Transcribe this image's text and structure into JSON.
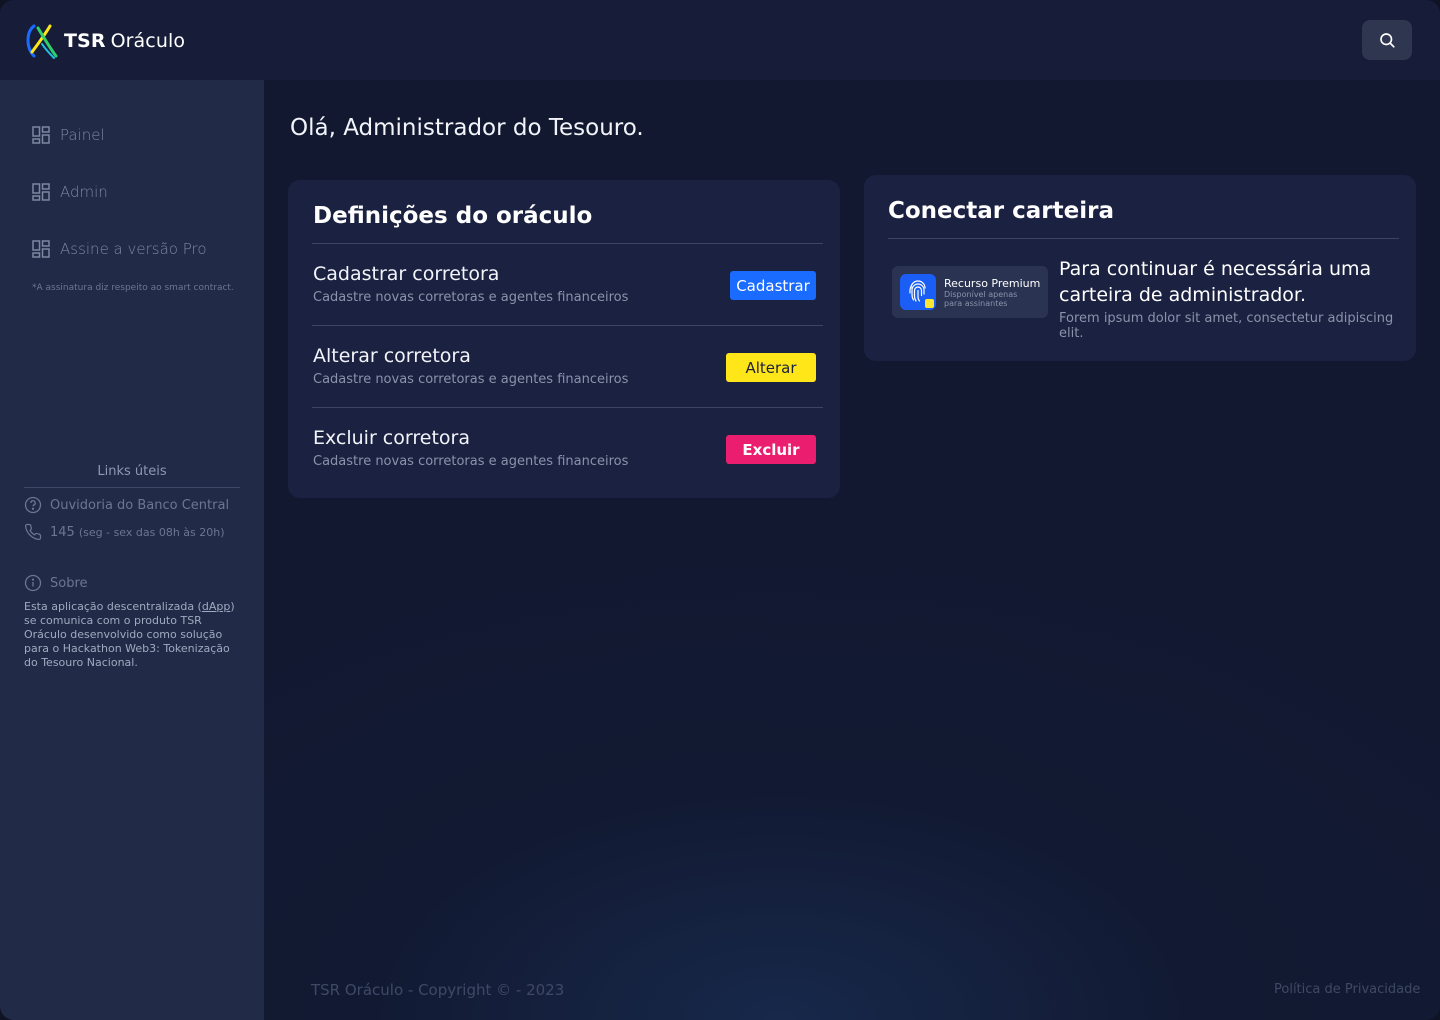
{
  "app": {
    "brand_bold": "TSR",
    "brand_name": "Oráculo"
  },
  "header": {
    "search_icon": "search-icon"
  },
  "sidebar": {
    "items": [
      {
        "label": "Painel",
        "icon": "dashboard-icon"
      },
      {
        "label": "Admin",
        "icon": "dashboard-icon"
      },
      {
        "label": "Assine a versão Pro",
        "icon": "dashboard-icon"
      }
    ],
    "signature_note": "*A assinatura diz respeito ao smart contract.",
    "links_title": "Links úteis",
    "links": [
      {
        "label": "Ouvidoria do Banco Central",
        "icon": "help-circle-icon"
      },
      {
        "label": "145",
        "sub": "(seg - sex das 08h às 20h)",
        "icon": "phone-icon"
      }
    ],
    "about_label": "Sobre",
    "about_text_1": "Esta aplicação descentralizada (",
    "about_link": "dApp",
    "about_text_2": ") se comunica com o produto TSR Oráculo desenvolvido como solução para o Hackathon Web3: Tokenização do Tesouro Nacional."
  },
  "main": {
    "greeting": "Olá, Administrador do Tesouro.",
    "oracle_card": {
      "title": "Definições do oráculo",
      "rows": [
        {
          "title": "Cadastrar corretora",
          "subtitle": "Cadastre novas corretoras e agentes financeiros",
          "button": "Cadastrar",
          "color": "#1a6bff"
        },
        {
          "title": "Alterar corretora",
          "subtitle": "Cadastre novas corretoras e agentes financeiros",
          "button": "Alterar",
          "color": "#ffe619"
        },
        {
          "title": "Excluir corretora",
          "subtitle": "Cadastre novas corretoras e agentes financeiros",
          "button": "Excluir",
          "color": "#ea1d6e"
        }
      ]
    },
    "wallet_card": {
      "title": "Conectar carteira",
      "premium_title": "Recurso Premium",
      "premium_sub": "Disponível apenas para assinantes",
      "message": "Para continuar é necessária uma carteira de administrador.",
      "description": "Forem ipsum dolor sit amet, consectetur adipiscing elit."
    }
  },
  "footer": {
    "copyright": "TSR Oráculo - Copyright © - 2023",
    "privacy": "Política de Privacidade"
  }
}
